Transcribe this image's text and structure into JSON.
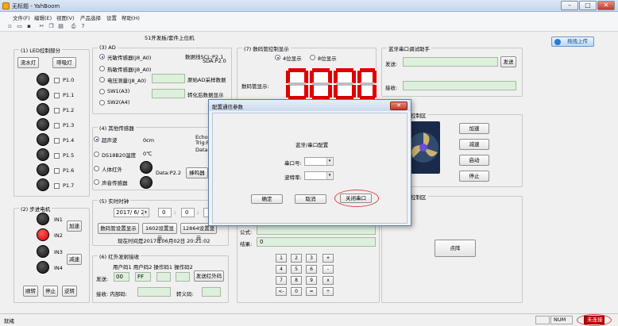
{
  "window": {
    "title": "无标题 - YahBoom",
    "colors": {
      "accent": "#e00000",
      "green_field": "#ddf0dd",
      "title_bar": "#c5d6ec"
    }
  },
  "menu": [
    "文件(F)",
    "编辑(E)",
    "视图(V)",
    "产品选择",
    "设置",
    "帮助(H)"
  ],
  "toolbar_icons": [
    "new-file-icon",
    "open-folder-icon",
    "save-icon",
    "cut-icon",
    "copy-icon",
    "paste-icon",
    "print-icon",
    "help-icon"
  ],
  "header": {
    "subtitle": "51开发板/套件上位机",
    "upload_label": "拖拽上传"
  },
  "led": {
    "title": "(1) LED控制部分",
    "btn_water": "流水灯",
    "btn_breath": "呼吸灯",
    "items": [
      "P1.0",
      "P1.1",
      "P1.2",
      "P1.3",
      "P1.4",
      "P1.5",
      "P1.6",
      "P1.7"
    ]
  },
  "ad": {
    "title": "(3) AD",
    "options": [
      "光敏传感器(J8_A0)",
      "热敏传感器(J8_A0)",
      "电压测量(J8_A0)",
      "SW1(A3)",
      "SW2(A4)"
    ],
    "pin_info_1": "数据线SCL:P2.1",
    "pin_info_2": "SDA:P2.0",
    "raw_label": "原始AD采样数据",
    "conv_label": "转化后数据显示"
  },
  "seg": {
    "title": "(7) 数码管控制显示",
    "opt4": "4位显示",
    "opt8": "8位显示",
    "label": "数码管显示:"
  },
  "serial": {
    "title": "蓝牙串口调试助手",
    "send_label": "发送:",
    "send_btn": "发送",
    "recv_label": "接收:"
  },
  "other": {
    "title": "(4) 其他传感器",
    "ultrasonic": "超声波",
    "cm": "0cm",
    "echo": "Echo",
    "trig": "Trig:P",
    "data": "Data:P",
    "ds18b20": "DS18B20温度",
    "temp": "0℃",
    "ir_body": "人体红外",
    "sound": "声音传感器",
    "data_pin": "Data:P2.2",
    "buzzer": "蜂鸣器"
  },
  "motor": {
    "title": "(2) 步进电机",
    "coils": [
      "IN1",
      "IN2",
      "IN3",
      "IN4"
    ],
    "accel": "加速",
    "decel": "减速",
    "ccw": "顺转",
    "stop": "停止",
    "cw": "逆转"
  },
  "rtc": {
    "title": "(5) 实时时钟",
    "date": "2017/ 6/ 2",
    "h": "0",
    "m": "0",
    "btn_seg": "数码管设置显示",
    "btn_1602": "1602设置显示",
    "btn_12864": "12864设置显示",
    "now": "现在时间是2017年06月02日 20:21:02"
  },
  "ir": {
    "title": "(6) 红外发射接收",
    "header": "用户码1 用户码2 操作码1 操作码2",
    "send_label": "发送:",
    "code1": "00",
    "code2": "FF",
    "send_btn": "发送红外码",
    "recv_label": "接收: 内部码:",
    "decode_label": "转义码:"
  },
  "fan": {
    "title": "控制区",
    "accel": "加速",
    "decel": "减速",
    "start": "启动",
    "stop": "停止"
  },
  "lower_right": {
    "title": "控制区",
    "btn": "点阵"
  },
  "calc": {
    "formula_label": "公式:",
    "result_label": "结果:",
    "result": "0",
    "keys": [
      "1",
      "2",
      "3",
      "+",
      "4",
      "5",
      "6",
      "-",
      "7",
      "8",
      "9",
      "x",
      "<-",
      "0",
      "=",
      "÷"
    ]
  },
  "dialog": {
    "title": "配置通信参数",
    "heading": "蓝牙/串口配置",
    "port_label": "串口号:",
    "baud_label": "波特率:",
    "ok": "确定",
    "cancel": "取消",
    "close_port": "关闭串口"
  },
  "status": {
    "ready": "就绪",
    "num": "NUM",
    "badge": "未连接"
  }
}
